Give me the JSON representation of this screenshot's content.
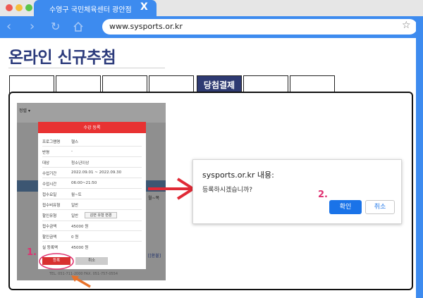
{
  "browser": {
    "tab_title": "수영구 국민체육센터 광안점",
    "tab_close": "X",
    "url": "www.sysports.or.kr",
    "colors": {
      "chrome": "#3d8bef",
      "titlebar": "#e6e6e6"
    }
  },
  "page": {
    "title": "온라인 신규추첨",
    "steps": [
      {
        "label": ""
      },
      {
        "label": ""
      },
      {
        "label": ""
      },
      {
        "label": ""
      },
      {
        "label": "당첨결제"
      },
      {
        "label": ""
      },
      {
        "label": ""
      }
    ],
    "accent": "#2b3a7b"
  },
  "screenshot": {
    "selector": "정렬 ▾",
    "side_value": "월~목",
    "side_link": "[[환불]",
    "footer": "TEL. 051-711-2000 FAX. 051-757-0554",
    "modal": {
      "title": "수강 등록",
      "fields": [
        {
          "label": "프로그램명",
          "value": "헬스"
        },
        {
          "label": "반명",
          "value": "-"
        },
        {
          "label": "대상",
          "value": "청소년이상"
        },
        {
          "label": "수업기간",
          "value": "2022.09.01 ~ 2022.09.30"
        },
        {
          "label": "수업시간",
          "value": "06:00~21:50"
        },
        {
          "label": "접수요일",
          "value": "월~토"
        },
        {
          "label": "접수비유형",
          "value": "일반"
        },
        {
          "label": "할인유형",
          "value": "일반"
        },
        {
          "label": "접수금액",
          "value": "45000 원"
        },
        {
          "label": "할인금액",
          "value": "0 원"
        },
        {
          "label": "실 등록액",
          "value": "45000 원"
        }
      ],
      "change_label": "감면 유형 변경",
      "register_label": "등록",
      "cancel_label": "취소"
    }
  },
  "dialog": {
    "title": "sysports.or.kr 내용:",
    "message": "등록하시겠습니까?",
    "ok_label": "확인",
    "cancel_label": "취소"
  },
  "annotations": {
    "step1": "1.",
    "step2": "2.",
    "highlight_color": "#e0306e",
    "arrow_color": "#e02a36",
    "pointer_color": "#e8722a"
  }
}
